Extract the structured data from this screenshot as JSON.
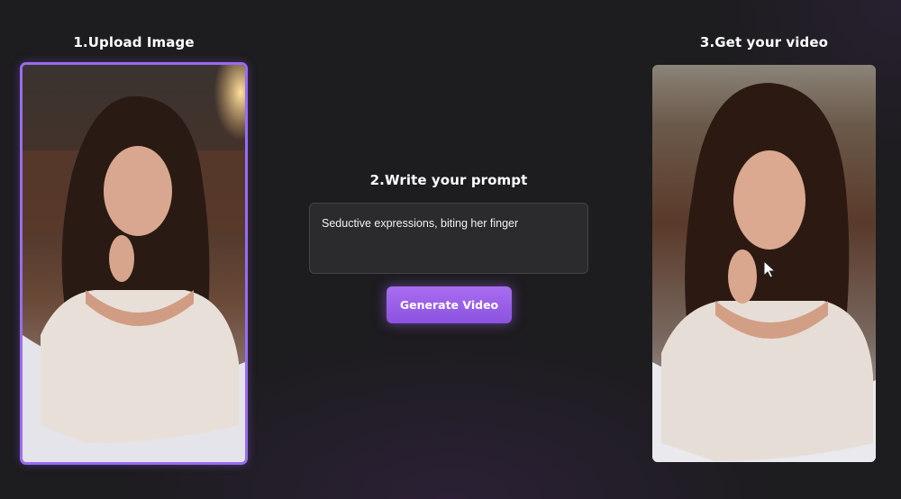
{
  "steps": {
    "upload": {
      "title": "1.Upload Image"
    },
    "prompt": {
      "title": "2.Write your prompt",
      "value": "Seductive expressions, biting her finger"
    },
    "result": {
      "title": "3.Get your video"
    }
  },
  "actions": {
    "generate_label": "Generate Video"
  },
  "colors": {
    "background": "#1d1c1f",
    "accent": "#9a6cf0",
    "button": "#9a5cf0",
    "prompt_box": "#2b2a2d"
  },
  "icons": {
    "cursor": "mouse-pointer-icon"
  }
}
